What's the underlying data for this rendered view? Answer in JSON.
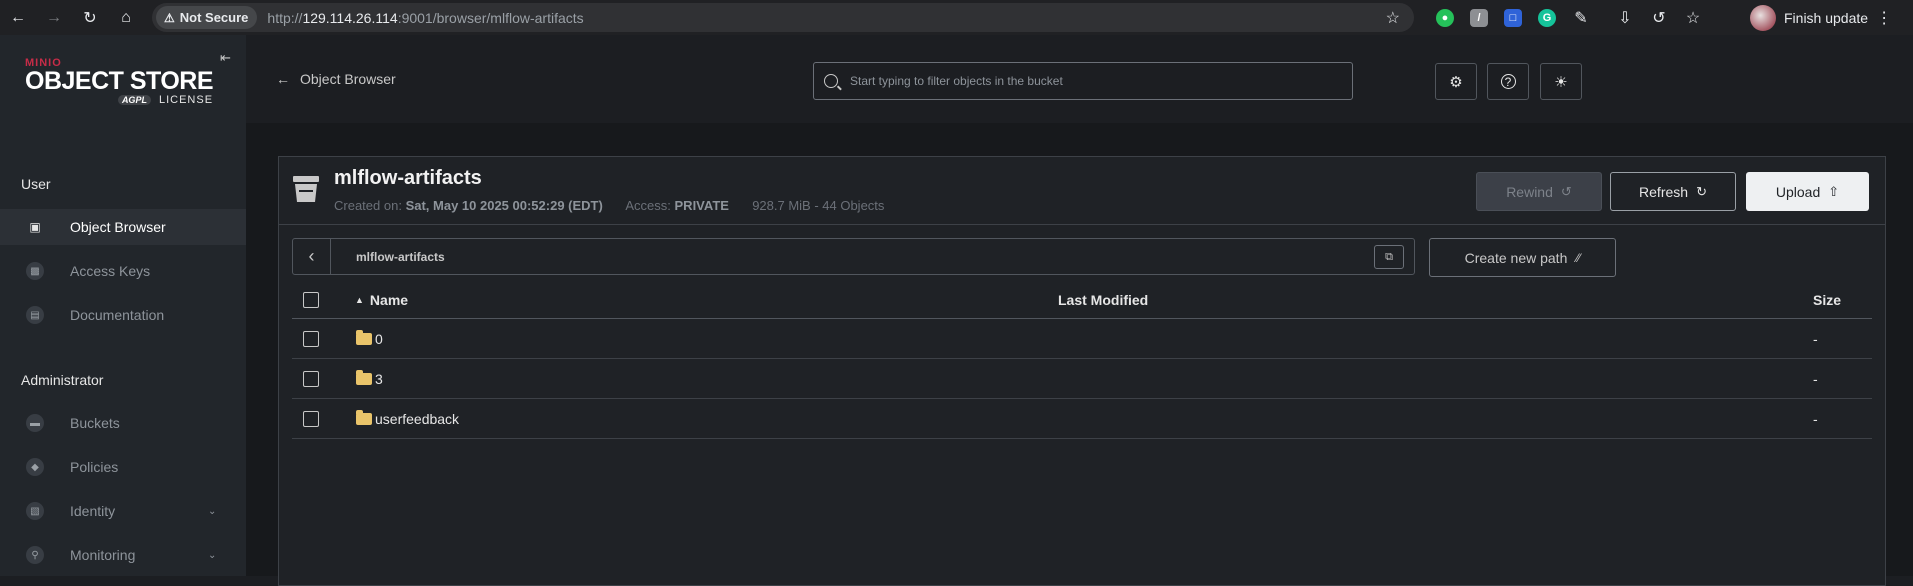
{
  "browser": {
    "security_chip": "Not Secure",
    "url_host": "129.114.26.114",
    "url_prefix": "http://",
    "url_rest": ":9001/browser/mlflow-artifacts",
    "finish_update": "Finish update"
  },
  "sidebar": {
    "logo_brand": "MINIO",
    "logo_product": "OBJECT STORE",
    "logo_license_badge": "AGPL",
    "logo_license": "LICENSE",
    "section_user": "User",
    "user_items": [
      {
        "label": "Object Browser",
        "icon": "object-browser-icon",
        "active": true
      },
      {
        "label": "Access Keys",
        "icon": "access-keys-icon"
      },
      {
        "label": "Documentation",
        "icon": "documentation-icon"
      }
    ],
    "section_admin": "Administrator",
    "admin_items": [
      {
        "label": "Buckets",
        "icon": "buckets-icon"
      },
      {
        "label": "Policies",
        "icon": "policies-icon"
      },
      {
        "label": "Identity",
        "icon": "identity-icon",
        "expandable": true
      },
      {
        "label": "Monitoring",
        "icon": "monitoring-icon",
        "expandable": true
      }
    ]
  },
  "topbar": {
    "back_label": "Object Browser",
    "search_placeholder": "Start typing to filter objects in the bucket",
    "icons": [
      "settings-icon",
      "help-icon",
      "theme-icon"
    ]
  },
  "bucket": {
    "name": "mlflow-artifacts",
    "created_label": "Created on:",
    "created_value": "Sat, May 10 2025 00:52:29 (EDT)",
    "access_label": "Access:",
    "access_value": "PRIVATE",
    "usage": "928.7 MiB - 44 Objects",
    "rewind_label": "Rewind",
    "refresh_label": "Refresh",
    "upload_label": "Upload"
  },
  "path": {
    "current": "mlflow-artifacts",
    "create_label": "Create new path"
  },
  "table": {
    "headers": {
      "name": "Name",
      "modified": "Last Modified",
      "size": "Size"
    },
    "rows": [
      {
        "name": "0",
        "modified": "",
        "size": "-"
      },
      {
        "name": "3",
        "modified": "",
        "size": "-"
      },
      {
        "name": "userfeedback",
        "modified": "",
        "size": "-"
      }
    ]
  },
  "colors": {
    "brand_red": "#c72c48",
    "background": "#1c1e22",
    "sidebar": "#22262b",
    "folder": "#e9c46a"
  }
}
